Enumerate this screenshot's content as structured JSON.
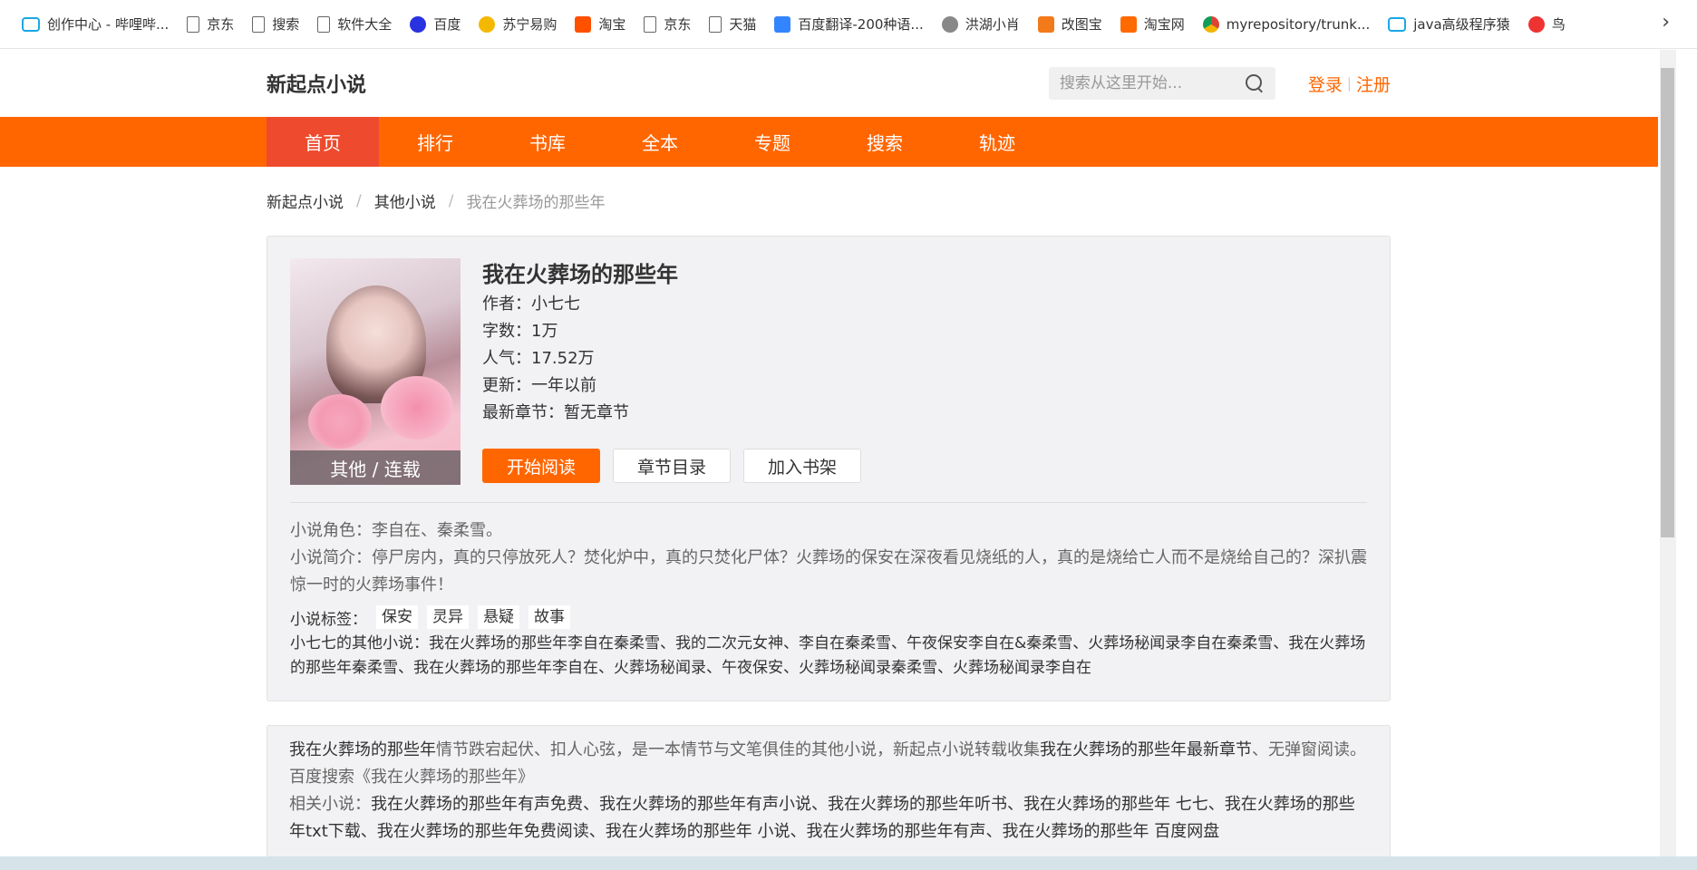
{
  "bookmarks": [
    {
      "label": "创作中心 - 哔哩哔...",
      "icon": "bilibili-icon",
      "cls": "bili"
    },
    {
      "label": "京东",
      "icon": "page-icon",
      "cls": "page"
    },
    {
      "label": "搜索",
      "icon": "page-icon",
      "cls": "page"
    },
    {
      "label": "软件大全",
      "icon": "page-icon",
      "cls": "page"
    },
    {
      "label": "百度",
      "icon": "baidu-paw-icon",
      "cls": "baidu"
    },
    {
      "label": "苏宁易购",
      "icon": "suning-icon",
      "cls": "suning"
    },
    {
      "label": "淘宝",
      "icon": "taobao-icon",
      "cls": "taobao"
    },
    {
      "label": "京东",
      "icon": "page-icon",
      "cls": "page"
    },
    {
      "label": "天猫",
      "icon": "page-icon",
      "cls": "page"
    },
    {
      "label": "百度翻译-200种语...",
      "icon": "translate-icon",
      "cls": "fanyi"
    },
    {
      "label": "洪湖小肖",
      "icon": "bird-icon",
      "cls": "hunhu"
    },
    {
      "label": "改图宝",
      "icon": "gaitubao-icon",
      "cls": "gai"
    },
    {
      "label": "淘宝网",
      "icon": "taobao-icon",
      "cls": "tb2"
    },
    {
      "label": "myrepository/trunk...",
      "icon": "chrome-icon",
      "cls": "chrome"
    },
    {
      "label": "java高级程序猿",
      "icon": "bilibili-icon",
      "cls": "bili"
    },
    {
      "label": "鸟",
      "icon": "bird-icon",
      "cls": "niao"
    }
  ],
  "bookmarks_more": "›",
  "site": {
    "logo": "新起点小说",
    "search_placeholder": "搜索从这里开始...",
    "login": "登录",
    "separator": "|",
    "register": "注册"
  },
  "nav": [
    "首页",
    "排行",
    "书库",
    "全本",
    "专题",
    "搜索",
    "轨迹"
  ],
  "breadcrumb": {
    "home": "新起点小说",
    "category": "其他小说",
    "current": "我在火葬场的那些年",
    "slash": "/"
  },
  "book": {
    "title": "我在火葬场的那些年",
    "cover_tag": "其他 / 连载",
    "author_label": "作者：",
    "author": "小七七",
    "words_label": "字数：",
    "words": "1万",
    "popularity_label": "人气：",
    "popularity": "17.52万",
    "updated_label": "更新：",
    "updated": "一年以前",
    "latest_label": "最新章节：",
    "latest": "暂无章节",
    "btn_read": "开始阅读",
    "btn_toc": "章节目录",
    "btn_shelf": "加入书架",
    "roles": "小说角色：李自在、秦柔雪。",
    "intro": "小说简介：停尸房内，真的只停放死人？焚化炉中，真的只焚化尸体？火葬场的保安在深夜看见烧纸的人，真的是烧给亡人而不是烧给自己的？深扒震惊一时的火葬场事件！",
    "tags_label": "小说标签：",
    "tags": [
      "保安",
      "灵异",
      "悬疑",
      "故事"
    ],
    "others": "小七七的其他小说：我在火葬场的那些年李自在秦柔雪、我的二次元女神、李自在秦柔雪、午夜保安李自在&秦柔雪、火葬场秘闻录李自在秦柔雪、我在火葬场的那些年秦柔雪、我在火葬场的那些年李自在、火葬场秘闻录、午夜保安、火葬场秘闻录秦柔雪、火葬场秘闻录李自在"
  },
  "seo": {
    "p1_title": "我在火葬场的那些年",
    "p1_mid": "情节跌宕起伏、扣人心弦，是一本情节与文笔俱佳的其他小说，新起点小说转载收集",
    "p1_title2": "我在火葬场的那些年最新章节",
    "p1_end": "、无弹窗阅读。百度搜索《我在火葬场的那些年》",
    "p2_label": "相关小说：",
    "p2_text": "我在火葬场的那些年有声免费、我在火葬场的那些年有声小说、我在火葬场的那些年听书、我在火葬场的那些年 七七、我在火葬场的那些年txt下载、我在火葬场的那些年免费阅读、我在火葬场的那些年 小说、我在火葬场的那些年有声、我在火葬场的那些年 百度网盘"
  }
}
